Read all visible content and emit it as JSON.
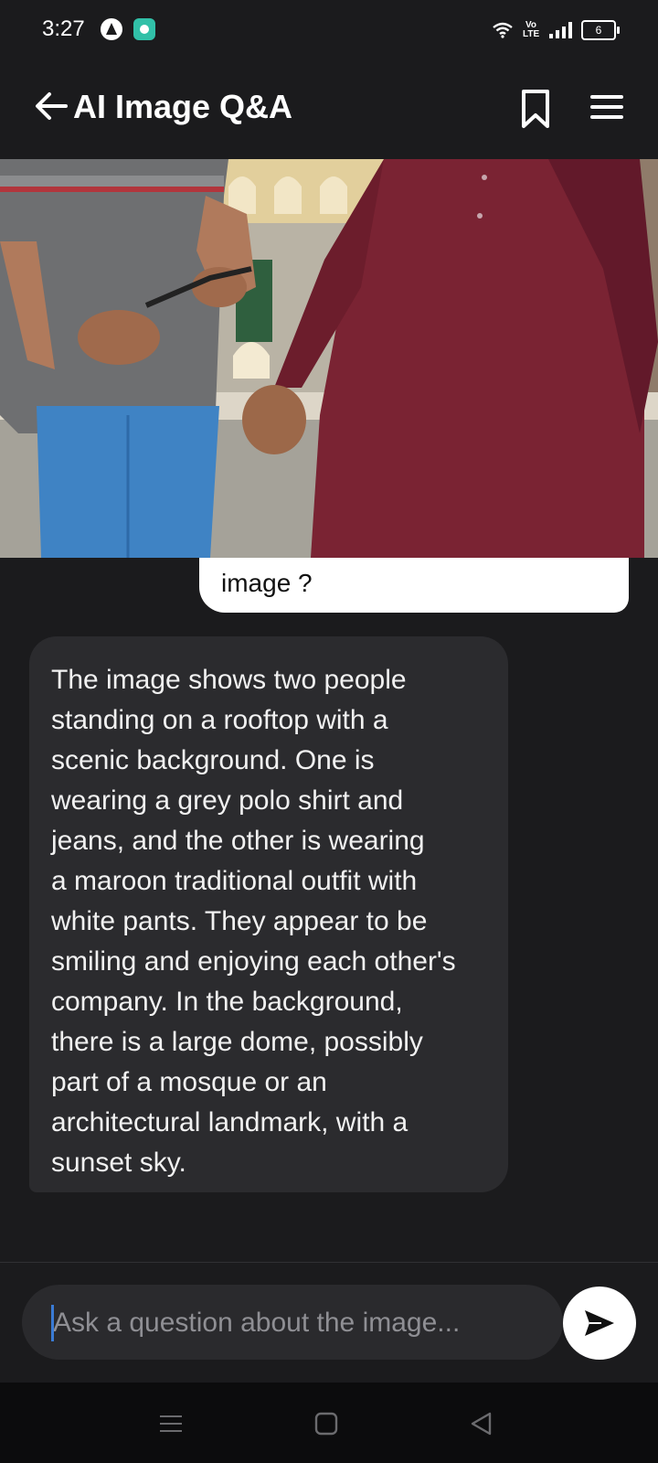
{
  "status_bar": {
    "time": "3:27",
    "network": "Vo LTE",
    "battery": "6"
  },
  "header": {
    "title": "AI Image Q&A"
  },
  "chat": {
    "user_message": "image ?",
    "ai_message": "The image shows two people\nstanding on a rooftop with a\nscenic background. One is\nwearing a grey polo shirt and\njeans, and the other is wearing\na maroon traditional outfit with\nwhite pants. They appear to be\nsmiling and enjoying each other's\ncompany. In the background,\nthere is a large dome, possibly\npart of a mosque or an\narchitectural landmark, with a\nsunset sky."
  },
  "composer": {
    "placeholder": "Ask a question about the image..."
  },
  "colors": {
    "background": "#1b1b1d",
    "ai_bubble": "#2b2b2e",
    "user_bubble": "#ffffff",
    "input_field": "#2a2a2d"
  },
  "icons": {
    "back": "arrow-left-icon",
    "bookmark": "bookmark-icon",
    "menu": "hamburger-menu-icon",
    "send": "send-icon"
  }
}
